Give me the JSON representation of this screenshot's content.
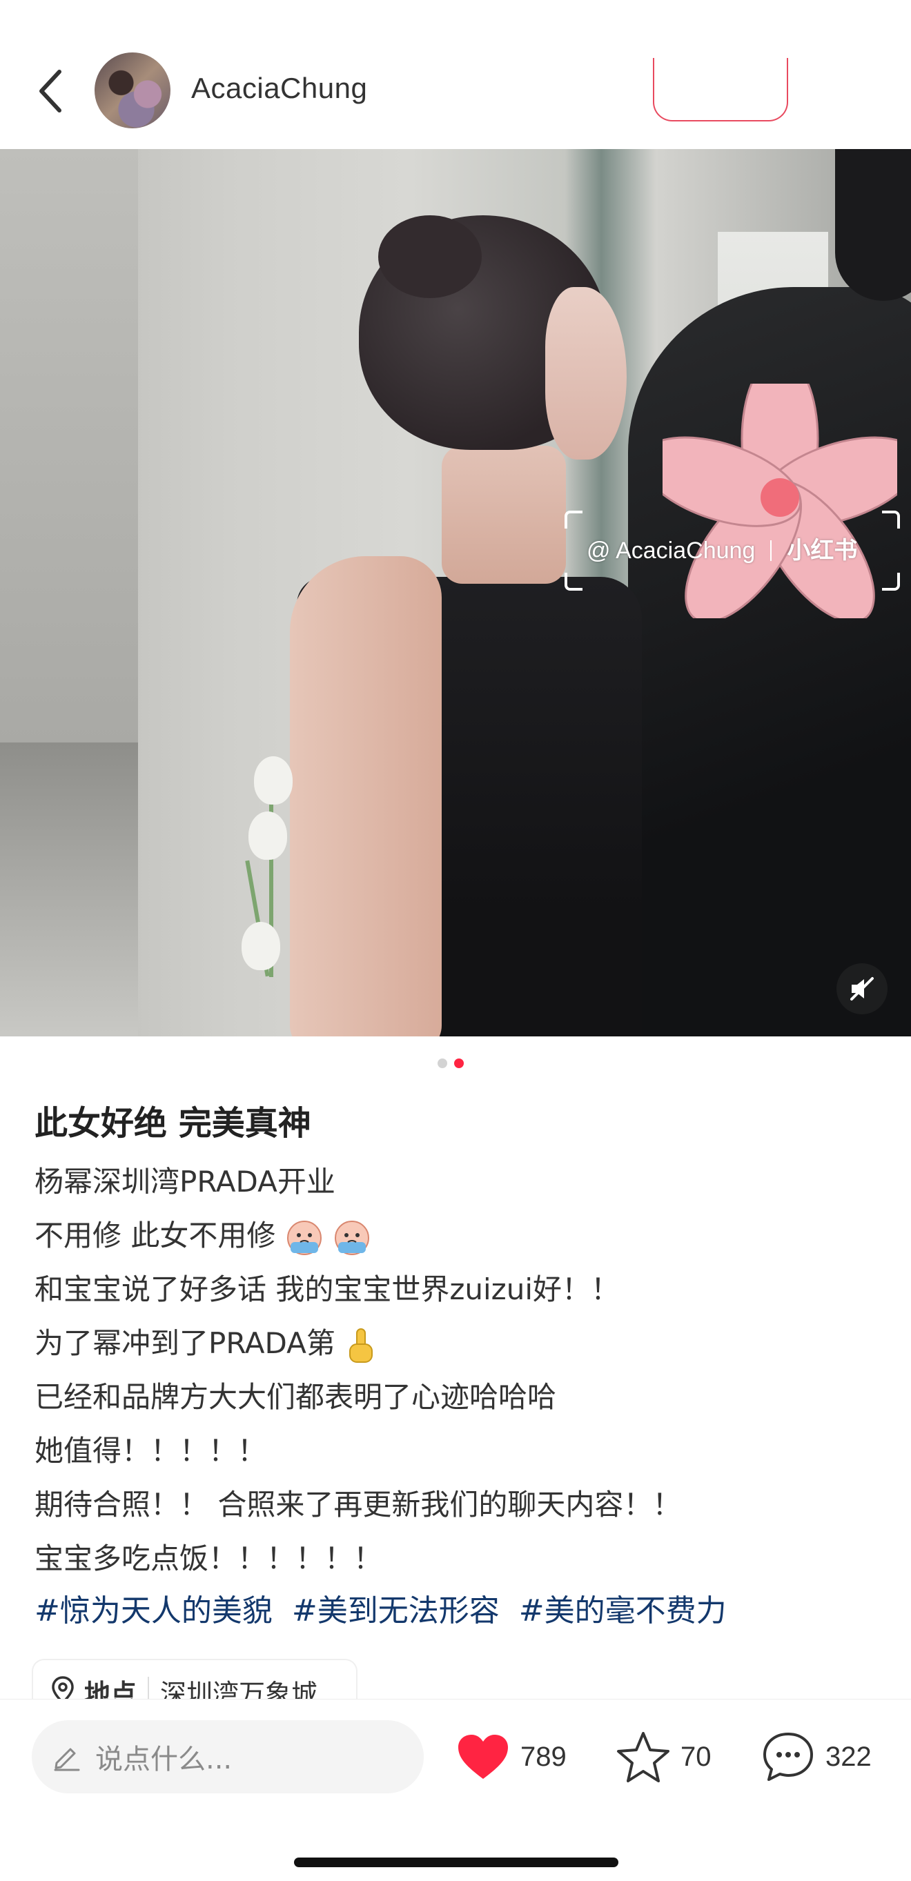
{
  "header": {
    "back_icon": "chevron-left-icon",
    "author_name": "AcaciaChung"
  },
  "photo": {
    "watermark_user": "@ AcaciaChung",
    "watermark_brand": "小红书",
    "mute_icon": "sound-off-icon"
  },
  "pager": {
    "total": 2,
    "active": 2
  },
  "post": {
    "title": "此女好绝 完美真神",
    "lines": [
      "杨幂深圳湾PRADA开业",
      "不用修 此女不用修",
      "和宝宝说了好多话 我的宝宝世界zuizui好！！",
      "为了幂冲到了PRADA第",
      "已经和品牌方大大们都表明了心迹哈哈哈",
      "她值得！！！！！",
      "期待合照！！ 合照来了再更新我们的聊天内容！！",
      "宝宝多吃点饭！！！！！！"
    ],
    "hashtags": [
      "#惊为天人的美貌",
      "#美到无法形容",
      "#美的毫不费力"
    ],
    "location": {
      "label": "地点",
      "name": "深圳湾万象城",
      "icon": "location-pin-icon"
    }
  },
  "bottom_bar": {
    "comment_placeholder": "说点什么...",
    "likes": "789",
    "stars": "70",
    "comments": "322",
    "like_color": "#ff2442"
  }
}
